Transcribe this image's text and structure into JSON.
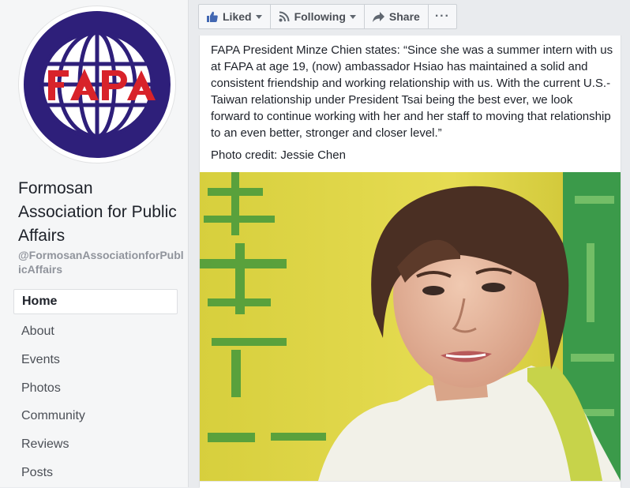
{
  "sidebar": {
    "logo_text": "FAPA",
    "page_name": "Formosan Association for Public Affairs",
    "handle": "@FormosanAssociationforPublicAffairs",
    "nav": [
      {
        "label": "Home",
        "active": true
      },
      {
        "label": "About"
      },
      {
        "label": "Events"
      },
      {
        "label": "Photos"
      },
      {
        "label": "Community"
      },
      {
        "label": "Reviews"
      },
      {
        "label": "Posts"
      }
    ]
  },
  "actions": {
    "liked": "Liked",
    "following": "Following",
    "share": "Share",
    "more": "···"
  },
  "post": {
    "text": "FAPA President Minze Chien states: “Since she was a summer intern with us at FAPA at age 19, (now) ambassador Hsiao has maintained a solid and consistent friendship and working relationship with us. With the current U.S.-Taiwan relationship under President Tsai being the best ever, we look forward to continue working with her and her staff to moving that relationship to an even better, stronger and closer level.”",
    "credit": "Photo credit: Jessie Chen"
  },
  "colors": {
    "logo_purple": "#2e1f7a",
    "logo_red": "#d8232a",
    "like_blue": "#4267b2"
  }
}
